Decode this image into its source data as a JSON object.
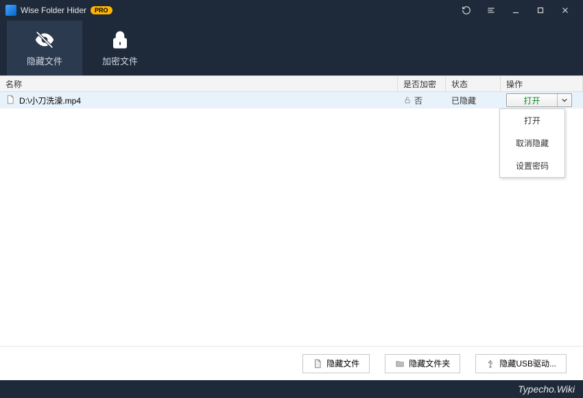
{
  "window": {
    "title": "Wise Folder Hider",
    "pro_badge": "PRO"
  },
  "tabs": {
    "hide": "隐藏文件",
    "encrypt": "加密文件"
  },
  "columns": {
    "name": "名称",
    "encrypted": "是否加密",
    "status": "状态",
    "action": "操作"
  },
  "row": {
    "filename": "D:\\小刀洗澡.mp4",
    "encrypted": "否",
    "status": "已隐藏",
    "action_label": "打开"
  },
  "dropdown": {
    "open": "打开",
    "unhide": "取消隐藏",
    "set_password": "设置密码"
  },
  "bottom": {
    "hide_file": "隐藏文件",
    "hide_folder": "隐藏文件夹",
    "hide_usb": "隐藏USB驱动..."
  },
  "watermark": "Typecho.Wiki"
}
